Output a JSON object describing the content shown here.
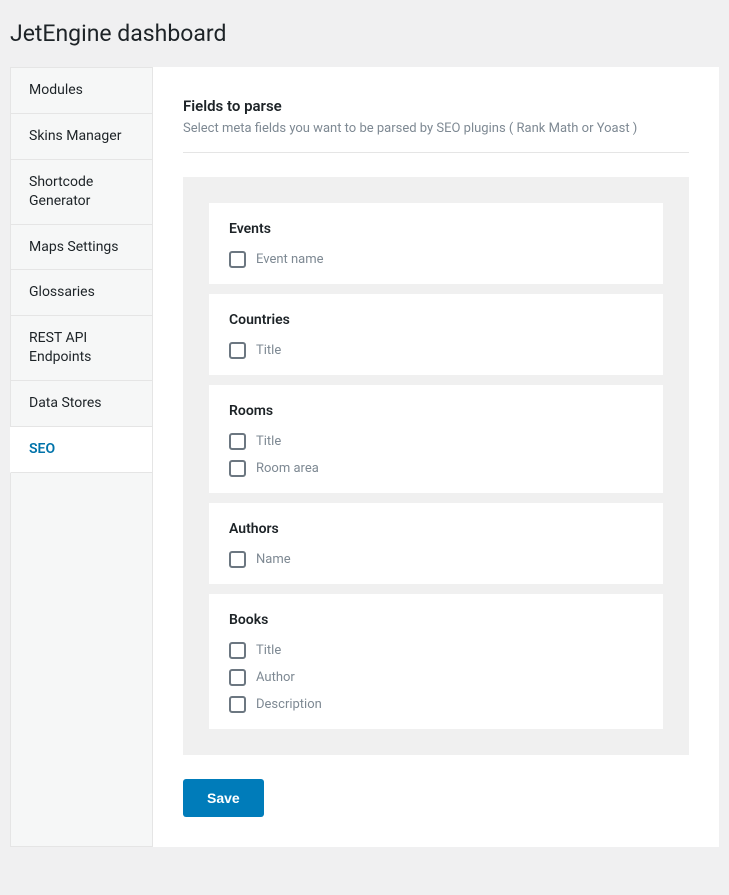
{
  "page": {
    "title": "JetEngine dashboard"
  },
  "sidebar": {
    "items": [
      {
        "label": "Modules"
      },
      {
        "label": "Skins Manager"
      },
      {
        "label": "Shortcode Generator"
      },
      {
        "label": "Maps Settings"
      },
      {
        "label": "Glossaries"
      },
      {
        "label": "REST API Endpoints"
      },
      {
        "label": "Data Stores"
      },
      {
        "label": "SEO"
      }
    ],
    "active_index": 7
  },
  "main": {
    "section_title": "Fields to parse",
    "section_desc": "Select meta fields you want to be parsed by SEO plugins ( Rank Math or Yoast )",
    "groups": [
      {
        "title": "Events",
        "fields": [
          {
            "label": "Event name"
          }
        ]
      },
      {
        "title": "Countries",
        "fields": [
          {
            "label": "Title"
          }
        ]
      },
      {
        "title": "Rooms",
        "fields": [
          {
            "label": "Title"
          },
          {
            "label": "Room area"
          }
        ]
      },
      {
        "title": "Authors",
        "fields": [
          {
            "label": "Name"
          }
        ]
      },
      {
        "title": "Books",
        "fields": [
          {
            "label": "Title"
          },
          {
            "label": "Author"
          },
          {
            "label": "Description"
          }
        ]
      }
    ],
    "save_label": "Save"
  }
}
